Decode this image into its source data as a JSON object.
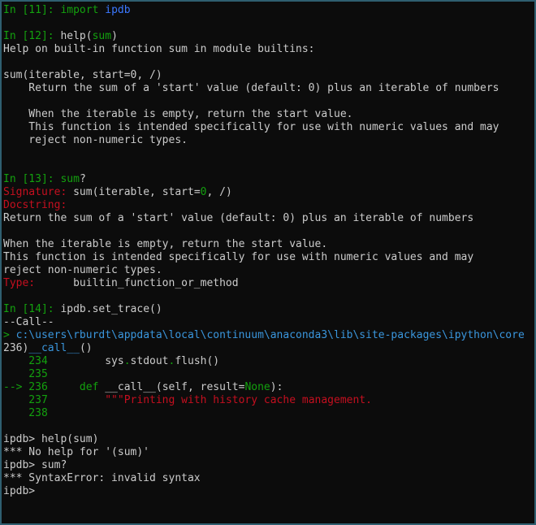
{
  "colors": {
    "background": "#0c0c0c",
    "foreground": "#cccccc",
    "prompt_green": "#13a10e",
    "error_red": "#c50f1f",
    "keyword_blue": "#3b78ff",
    "path_cyan": "#3a96dd",
    "border": "#2f5f70"
  },
  "lines": [
    {
      "segs": [
        {
          "t": "In [11]: ",
          "c": "green"
        },
        {
          "t": "import ",
          "c": "green"
        },
        {
          "t": "ipdb",
          "c": "blue"
        }
      ]
    },
    {
      "segs": [
        {
          "t": "",
          "c": "dim"
        }
      ]
    },
    {
      "segs": [
        {
          "t": "In [12]: ",
          "c": "green"
        },
        {
          "t": "help(",
          "c": "dim"
        },
        {
          "t": "sum",
          "c": "green"
        },
        {
          "t": ")",
          "c": "dim"
        }
      ]
    },
    {
      "segs": [
        {
          "t": "Help on built-in function sum in module builtins:",
          "c": "dim"
        }
      ]
    },
    {
      "segs": [
        {
          "t": "",
          "c": "dim"
        }
      ]
    },
    {
      "segs": [
        {
          "t": "sum(iterable, start=0, /)",
          "c": "dim"
        }
      ]
    },
    {
      "segs": [
        {
          "t": "    Return the sum of a 'start' value (default: 0) plus an iterable of numbers",
          "c": "dim"
        }
      ]
    },
    {
      "segs": [
        {
          "t": "",
          "c": "dim"
        }
      ]
    },
    {
      "segs": [
        {
          "t": "    When the iterable is empty, return the start value.",
          "c": "dim"
        }
      ]
    },
    {
      "segs": [
        {
          "t": "    This function is intended specifically for use with numeric values and may",
          "c": "dim"
        }
      ]
    },
    {
      "segs": [
        {
          "t": "    reject non-numeric types.",
          "c": "dim"
        }
      ]
    },
    {
      "segs": [
        {
          "t": "",
          "c": "dim"
        }
      ]
    },
    {
      "segs": [
        {
          "t": "",
          "c": "dim"
        }
      ]
    },
    {
      "segs": [
        {
          "t": "In [13]: ",
          "c": "green"
        },
        {
          "t": "sum",
          "c": "green"
        },
        {
          "t": "?",
          "c": "dim"
        }
      ]
    },
    {
      "segs": [
        {
          "t": "Signature: ",
          "c": "red"
        },
        {
          "t": "sum",
          "c": "dim"
        },
        {
          "t": "(",
          "c": "dim"
        },
        {
          "t": "iterable",
          "c": "dim"
        },
        {
          "t": ", ",
          "c": "dim"
        },
        {
          "t": "start",
          "c": "dim"
        },
        {
          "t": "=",
          "c": "dim"
        },
        {
          "t": "0",
          "c": "green"
        },
        {
          "t": ", /)",
          "c": "dim"
        }
      ]
    },
    {
      "segs": [
        {
          "t": "Docstring:",
          "c": "red"
        }
      ]
    },
    {
      "segs": [
        {
          "t": "Return the sum of a 'start' value (default: 0) plus an iterable of numbers",
          "c": "dim"
        }
      ]
    },
    {
      "segs": [
        {
          "t": "",
          "c": "dim"
        }
      ]
    },
    {
      "segs": [
        {
          "t": "When the iterable is empty, return the start value.",
          "c": "dim"
        }
      ]
    },
    {
      "segs": [
        {
          "t": "This function is intended specifically for use with numeric values and may",
          "c": "dim"
        }
      ]
    },
    {
      "segs": [
        {
          "t": "reject non-numeric types.",
          "c": "dim"
        }
      ]
    },
    {
      "segs": [
        {
          "t": "Type:      ",
          "c": "red"
        },
        {
          "t": "builtin_function_or_method",
          "c": "dim"
        }
      ]
    },
    {
      "segs": [
        {
          "t": "",
          "c": "dim"
        }
      ]
    },
    {
      "segs": [
        {
          "t": "In [14]: ",
          "c": "green"
        },
        {
          "t": "ipdb.set_trace()",
          "c": "dim"
        }
      ]
    },
    {
      "segs": [
        {
          "t": "--Call--",
          "c": "dim"
        }
      ]
    },
    {
      "segs": [
        {
          "t": "> ",
          "c": "green"
        },
        {
          "t": "c:\\users\\rburdt\\appdata\\local\\continuum\\anaconda3\\lib\\site-packages\\ipython\\core",
          "c": "cyan"
        }
      ]
    },
    {
      "segs": [
        {
          "t": "236)",
          "c": "dim"
        },
        {
          "t": "__call__",
          "c": "cyan"
        },
        {
          "t": "()",
          "c": "dim"
        }
      ]
    },
    {
      "segs": [
        {
          "t": "    234         ",
          "c": "green"
        },
        {
          "t": "sys",
          "c": "dim"
        },
        {
          "t": ".",
          "c": "green"
        },
        {
          "t": "stdout",
          "c": "dim"
        },
        {
          "t": ".",
          "c": "green"
        },
        {
          "t": "flush",
          "c": "dim"
        },
        {
          "t": "()",
          "c": "dim"
        }
      ]
    },
    {
      "segs": [
        {
          "t": "    235",
          "c": "green"
        }
      ]
    },
    {
      "segs": [
        {
          "t": "--> 236     ",
          "c": "green"
        },
        {
          "t": "def ",
          "c": "green"
        },
        {
          "t": "__call__",
          "c": "dim"
        },
        {
          "t": "(",
          "c": "dim"
        },
        {
          "t": "self",
          "c": "dim"
        },
        {
          "t": ", ",
          "c": "dim"
        },
        {
          "t": "result",
          "c": "dim"
        },
        {
          "t": "=",
          "c": "dim"
        },
        {
          "t": "None",
          "c": "green"
        },
        {
          "t": "):",
          "c": "dim"
        }
      ]
    },
    {
      "segs": [
        {
          "t": "    237         ",
          "c": "green"
        },
        {
          "t": "\"\"\"Printing with history cache management.",
          "c": "red"
        }
      ]
    },
    {
      "segs": [
        {
          "t": "    238",
          "c": "green"
        }
      ]
    },
    {
      "segs": [
        {
          "t": "",
          "c": "dim"
        }
      ]
    },
    {
      "segs": [
        {
          "t": "ipdb> help(sum)",
          "c": "dim"
        }
      ]
    },
    {
      "segs": [
        {
          "t": "*** No help for '(sum)'",
          "c": "dim"
        }
      ]
    },
    {
      "segs": [
        {
          "t": "ipdb> sum?",
          "c": "dim"
        }
      ]
    },
    {
      "segs": [
        {
          "t": "*** SyntaxError: invalid syntax",
          "c": "dim"
        }
      ]
    },
    {
      "segs": [
        {
          "t": "ipdb>",
          "c": "dim"
        }
      ]
    }
  ]
}
